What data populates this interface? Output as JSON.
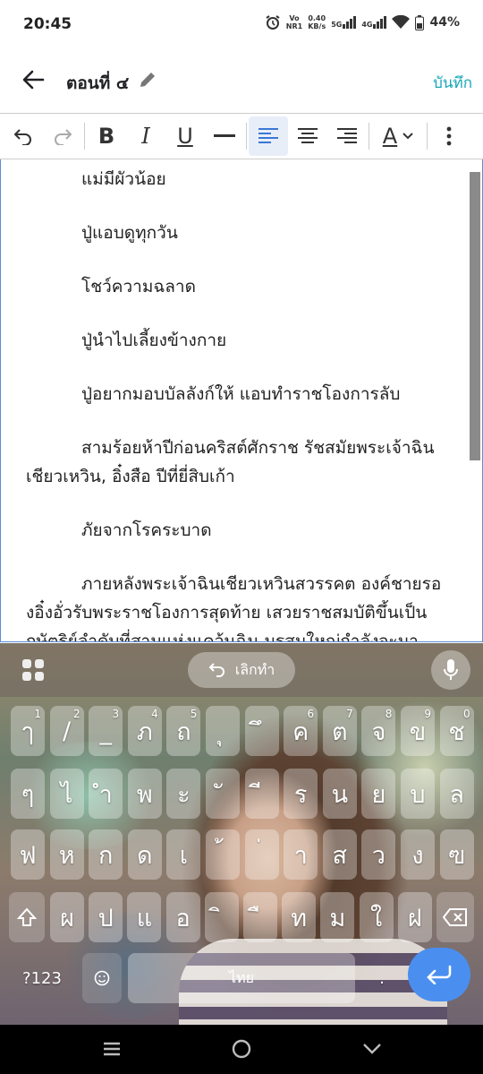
{
  "status": {
    "time": "20:45",
    "volte": "Vo",
    "volte_sub": "NR1",
    "speed": "0.40",
    "speed_unit": "KB/s",
    "net1": "5G",
    "net2": "4G",
    "battery": "44%"
  },
  "appbar": {
    "title": "ตอนที่ ๔",
    "save_label": "บันทึก"
  },
  "toolbar": {
    "items": [
      "undo-icon",
      "redo-icon",
      "bold-icon",
      "italic-icon",
      "underline-icon",
      "hr-icon",
      "align-left-icon",
      "align-center-icon",
      "align-right-icon",
      "text-color-icon",
      "more-icon"
    ],
    "bold": "B",
    "italic": "I",
    "underline": "U",
    "text_color": "A"
  },
  "editor": {
    "paragraphs": [
      "แม่มีผัวน้อย",
      "ปู่แอบดูทุกวัน",
      "โชว์ความฉลาด",
      "ปู่นำไปเลี้ยงข้างกาย",
      "ปู่อยากมอบบัลลังก์ให้ แอบทำราชโองการลับ",
      "สามร้อยห้าปีก่อนคริสต์ศักราช รัชสมัยพระเจ้าฉินเชียวเหวิน, อิ๋งสือ ปีที่ยี่สิบเก้า",
      "ภัยจากโรคระบาด",
      "ภายหลังพระเจ้าฉินเชียวเหวินสวรรคต องค์ชายรองอิ๋งอั่วรับพระราชโองการสุดท้าย เสวยราชสมบัติขึ้นเป็นกษัตริย์ลำดับที่สามแห่งแคว้นฉิน มรสุมใหญ่กำลังจะมาเยือน"
    ]
  },
  "keyboard": {
    "undo_label": "เลิกทำ",
    "row1": [
      {
        "k": "ๅ",
        "h": "1"
      },
      {
        "k": "/",
        "h": "2"
      },
      {
        "k": "_",
        "h": "3"
      },
      {
        "k": "ภ",
        "h": "4"
      },
      {
        "k": "ถ",
        "h": "5"
      },
      {
        "k": "ุ",
        "h": ""
      },
      {
        "k": "ึ",
        "h": ""
      },
      {
        "k": "ค",
        "h": "6"
      },
      {
        "k": "ต",
        "h": "7"
      },
      {
        "k": "จ",
        "h": "8"
      },
      {
        "k": "ข",
        "h": "9"
      },
      {
        "k": "ช",
        "h": "0"
      }
    ],
    "row2": [
      "ๆ",
      "ไ",
      "ำ",
      "พ",
      "ะ",
      "ั",
      "ี",
      "ร",
      "น",
      "ย",
      "บ",
      "ล"
    ],
    "row3": [
      "ฟ",
      "ห",
      "ก",
      "ด",
      "เ",
      "้",
      "่",
      "า",
      "ส",
      "ว",
      "ง",
      "ฃ"
    ],
    "row4": [
      "ผ",
      "ป",
      "แ",
      "อ",
      "ิ",
      "ื",
      "ท",
      "ม",
      "ใ",
      "ฝ"
    ],
    "symbols_label": "?123",
    "space_label": "ไทย",
    "period_label": "."
  }
}
